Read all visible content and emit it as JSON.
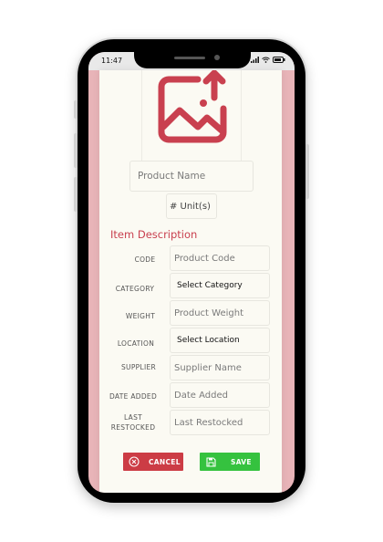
{
  "status_bar": {
    "time": "11:47"
  },
  "form": {
    "product_name_placeholder": "Product Name",
    "units_placeholder": "# Unit(s)",
    "section_title": "Item Description",
    "fields": [
      {
        "label": "CODE",
        "value": "Product Code",
        "kind": "input"
      },
      {
        "label": "CATEGORY",
        "value": "Select Category",
        "kind": "select"
      },
      {
        "label": "WEIGHT",
        "value": "Product Weight",
        "kind": "input"
      },
      {
        "label": "LOCATION",
        "value": "Select Location",
        "kind": "select"
      },
      {
        "label": "SUPPLIER",
        "value": "Supplier Name",
        "kind": "input"
      },
      {
        "label": "DATE ADDED",
        "value": "Date Added",
        "kind": "input"
      },
      {
        "label_line1": "LAST",
        "label_line2": "RESTOCKED",
        "value": "Last Restocked",
        "kind": "input"
      }
    ]
  },
  "actions": {
    "cancel_label": "CANCEL",
    "save_label": "SAVE"
  },
  "colors": {
    "accent": "#c9404f",
    "cancel": "#cc3c45",
    "save": "#35c23f",
    "screen_bg": "#e8b4b8"
  }
}
